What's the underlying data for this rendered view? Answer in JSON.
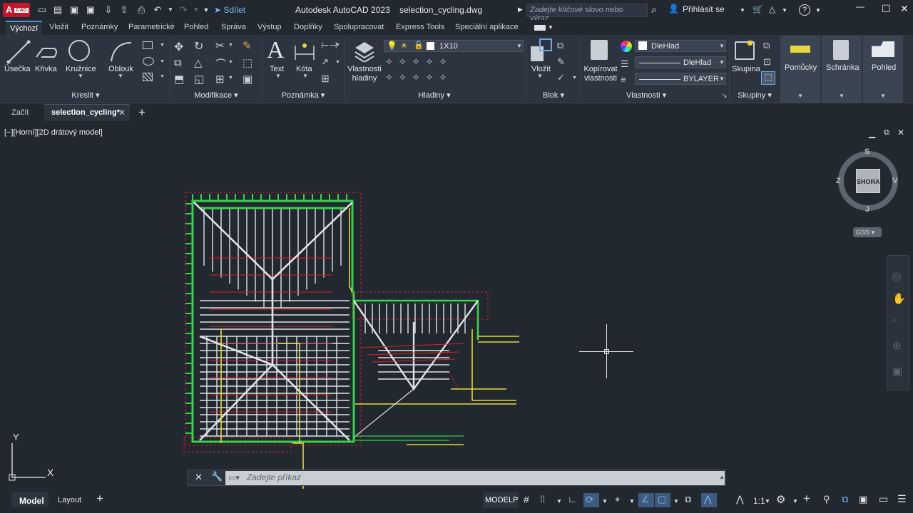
{
  "title_bar": {
    "logo_text": "A",
    "logo_badge": "CAD",
    "share_label": "Sdílet",
    "app_name": "Autodesk AutoCAD 2023",
    "file_name": "selection_cycling.dwg",
    "search_placeholder": "Zadejte klíčové slovo nebo výraz.",
    "sign_in": "Přihlásit se"
  },
  "ribbon_tabs": [
    "Výchozí",
    "Vložit",
    "Poznámky",
    "Parametrické",
    "Pohled",
    "Správa",
    "Výstup",
    "Doplňky",
    "Spolupracovat",
    "Express Tools",
    "Speciální aplikace"
  ],
  "ribbon": {
    "draw": {
      "tools": [
        "Úsečka",
        "Křivka",
        "Kružnice",
        "Oblouk"
      ],
      "group": "Kreslit"
    },
    "modify": {
      "group": "Modifikace"
    },
    "annotation": {
      "tools": [
        "Text",
        "Kóta"
      ],
      "group": "Poznámka"
    },
    "layers": {
      "tool": "Vlastnosti hladiny",
      "current_layer": "1X10",
      "group": "Hladiny"
    },
    "block": {
      "tool": "Vložit",
      "group": "Blok"
    },
    "properties": {
      "tool": "Kopírovat vlastnosti",
      "color": "DleHlad",
      "linetype": "DleHlad",
      "lineweight": "BYLAYER",
      "group": "Vlastnosti"
    },
    "groups": {
      "tool": "Skupina",
      "group": "Skupiny"
    },
    "utilities": "Pomůcky",
    "clipboard": "Schránka",
    "view": "Pohled"
  },
  "doc_tabs": {
    "start": "Začít",
    "active": "selection_cycling*"
  },
  "viewport": {
    "label": "[−][Horní][2D drátový model]"
  },
  "viewcube": {
    "face": "SHORA",
    "north": "S",
    "south": "J",
    "east": "V",
    "west": "Z",
    "ucs": "GSS"
  },
  "ucs_icon": {
    "x": "X",
    "y": "Y"
  },
  "command": {
    "placeholder": "Zadejte příkaz"
  },
  "status": {
    "model_tab": "Model",
    "layout_tab": "Layout",
    "space": "MODELP",
    "scale": "1:1"
  },
  "colors": {
    "bg": "#212830",
    "ribbon": "#2c3440",
    "green": "#35d24a",
    "yellow": "#e5d83c",
    "red": "#e02020",
    "white": "#dfe3e8"
  }
}
